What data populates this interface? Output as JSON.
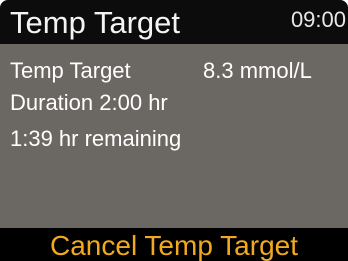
{
  "screen": {
    "title": "Temp Target",
    "clock": "09:00"
  },
  "details": {
    "target_label": "Temp Target",
    "target_value": "8.3 mmol/L",
    "duration": "Duration 2:00 hr",
    "remaining": "1:39 hr remaining"
  },
  "actions": {
    "cancel_label": "Cancel Temp Target"
  },
  "colors": {
    "title_bar_bg": "#0c0c0c",
    "content_bg": "#6b6763",
    "action_text": "#f2a91e"
  }
}
